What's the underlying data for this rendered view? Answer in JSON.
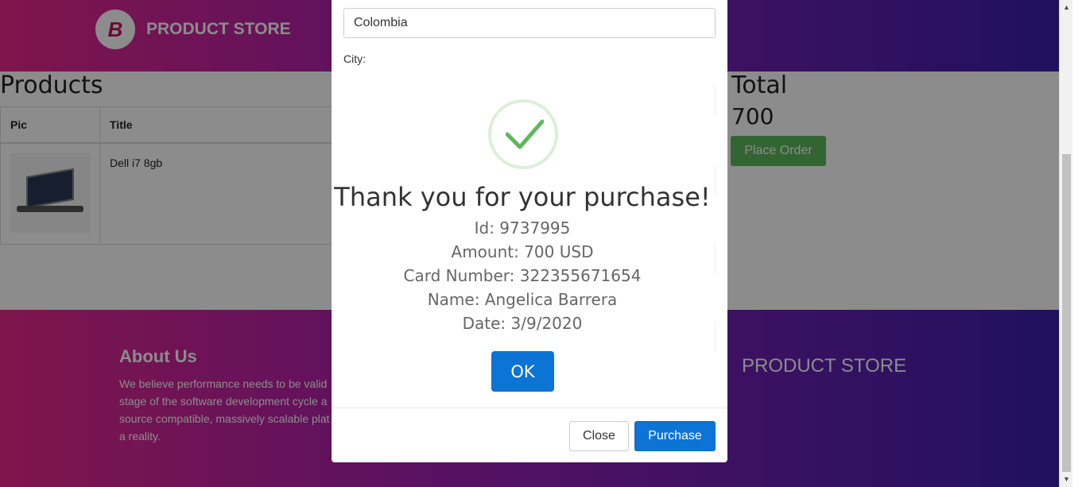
{
  "navbar": {
    "brand_logo": "B",
    "brand_text": "PRODUCT STORE"
  },
  "products": {
    "heading": "Products",
    "columns": [
      "Pic",
      "Title"
    ],
    "rows": [
      {
        "title": "Dell i7 8gb"
      }
    ]
  },
  "cart": {
    "total_heading": "Total",
    "total_value": "700",
    "place_order_label": "Place Order"
  },
  "footer": {
    "about_title": "About Us",
    "about_lines": [
      "We believe performance needs to be valid",
      "stage of the software development cycle a",
      "source compatible, massively scalable plat",
      "a reality."
    ],
    "brand_text": "PRODUCT STORE"
  },
  "order_modal": {
    "country_value": "Colombia",
    "city_label": "City:",
    "close_label": "Close",
    "purchase_label": "Purchase"
  },
  "alert": {
    "title": "Thank you for your purchase!",
    "lines": [
      "Id: 9737995",
      "Amount: 700 USD",
      "Card Number: 322355671654",
      "Name: Angelica Barrera",
      "Date: 3/9/2020"
    ],
    "ok_label": "OK",
    "icon": "checkmark-icon",
    "success_color": "#5cb85c"
  },
  "colors": {
    "primary": "#0b74d5",
    "success": "#5cb85c",
    "brand_pink": "#e8278c",
    "brand_purple": "#3a1fae"
  }
}
